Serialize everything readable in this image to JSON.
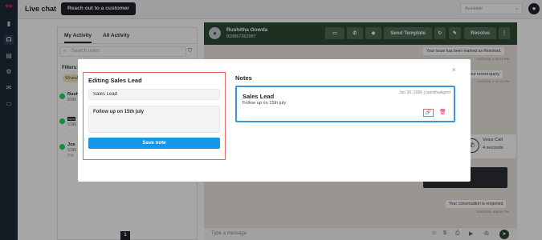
{
  "topbar": {
    "title": "Live chat",
    "reach_out_label": "Reach out to a customer",
    "status_value": "Available"
  },
  "contacts_panel": {
    "tabs": [
      {
        "label": "My Activity"
      },
      {
        "label": "All Activity"
      }
    ],
    "search_placeholder": "Search users",
    "filters_label": "Filters:",
    "filter_chip": "WhatsApp",
    "contacts": [
      {
        "name": "Rush",
        "phone": "9186",
        "snippet": "..."
      },
      {
        "badge": "New",
        "phone": "9186",
        "snippet": "..."
      },
      {
        "name": "Joe",
        "phone": "9186",
        "snippet": "PM"
      }
    ],
    "page_number": "1"
  },
  "chat": {
    "contact_name": "Rushitha Gowda",
    "contact_phone": "918867262987",
    "send_template_label": "Send Template",
    "resolve_label": "Resolve",
    "messages": [
      {
        "text": "Your issue has been marked as Resolved.",
        "meta": "2/26/2026, 1:08:16 PM"
      },
      {
        "text": "Thanks for your recent query",
        "meta": "2/26/2026, 1:42:30 PM"
      },
      {
        "text": "Your conversation is reopened",
        "meta": "3/26/2026, 8:56:51 PM"
      }
    ],
    "voice_call": {
      "title": "Voice Call",
      "duration": "4 seconds"
    },
    "dark_msg": "order number",
    "input_placeholder": "Type a message"
  },
  "modal": {
    "edit_title": "Editing Sales Lead",
    "title_input_value": "Sales Lead",
    "body_value": "Follow up on 15th july",
    "save_label": "Save note",
    "notes_title": "Notes",
    "note": {
      "title": "Sales Lead",
      "body": "Follow up on 15th july",
      "meta": "Jun 26, 2026 | rushithaAgent"
    }
  },
  "colors": {
    "rail": "#1f2a3a",
    "chat_header": "#2e4a35",
    "primary": "#1596e6",
    "highlight": "#e9655f"
  }
}
